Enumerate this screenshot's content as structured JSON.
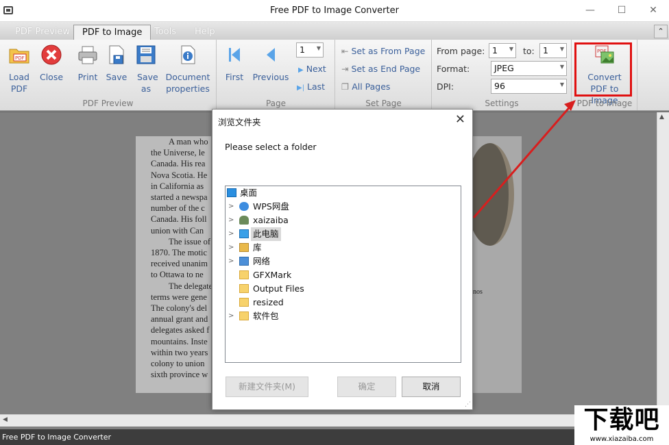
{
  "window": {
    "title": "Free PDF to Image Converter"
  },
  "tabs": [
    {
      "label": "PDF Preview"
    },
    {
      "label": "PDF to Image"
    },
    {
      "label": "Tools"
    },
    {
      "label": "Help"
    }
  ],
  "ribbon": {
    "preview_group": {
      "label": "PDF Preview",
      "load": "Load PDF",
      "close": "Close",
      "print": "Print",
      "save": "Save",
      "save_as": "Save as",
      "doc_props": "Document properties"
    },
    "page_group": {
      "label": "Page",
      "first": "First",
      "previous": "Previous",
      "next": "Next",
      "last": "Last",
      "page_value": "1"
    },
    "set_page_group": {
      "label": "Set Page",
      "from": "Set as From Page",
      "end": "Set as End Page",
      "all": "All Pages"
    },
    "settings_group": {
      "label": "Settings",
      "from_page_label": "From page:",
      "from_page_value": "1",
      "to_label": "to:",
      "to_value": "1",
      "format_label": "Format:",
      "format_value": "JPEG",
      "dpi_label": "DPI:",
      "dpi_value": "96"
    },
    "convert_group": {
      "label": "PDF to Image",
      "convert": "Convert PDF to Image"
    }
  },
  "document": {
    "lines": [
      "A man who",
      "the Universe, le",
      "Canada. His rea",
      "Nova Scotia. He",
      "in California as",
      "started a newspa",
      "number of the c",
      "Canada. His foll",
      "union with Can",
      "The issue of",
      "1870. The motic",
      "received unanim",
      "to Ottawa to ne",
      "The delegate",
      "terms were gene",
      "The colony's del",
      "annual grant and",
      "delegates asked f",
      "mountains. Inste",
      "within two years",
      "colony to union",
      "sixth province w"
    ],
    "caption": "nos"
  },
  "dialog": {
    "title": "浏览文件夹",
    "message": "Please select a folder",
    "tree": [
      {
        "label": "桌面"
      },
      {
        "label": "WPS网盘"
      },
      {
        "label": "xaizaiba"
      },
      {
        "label": "此电脑"
      },
      {
        "label": "库"
      },
      {
        "label": "网络"
      },
      {
        "label": "GFXMark"
      },
      {
        "label": "Output Files"
      },
      {
        "label": "resized"
      },
      {
        "label": "软件包"
      }
    ],
    "new_folder": "新建文件夹(M)",
    "ok": "确定",
    "cancel": "取消"
  },
  "status": {
    "text": "Free PDF to Image Converter"
  },
  "watermark": {
    "text": "下载吧",
    "url": "www.xiazaiba.com"
  },
  "colors": {
    "accent_blue": "#3a5f9a",
    "highlight_red": "#e01010"
  }
}
